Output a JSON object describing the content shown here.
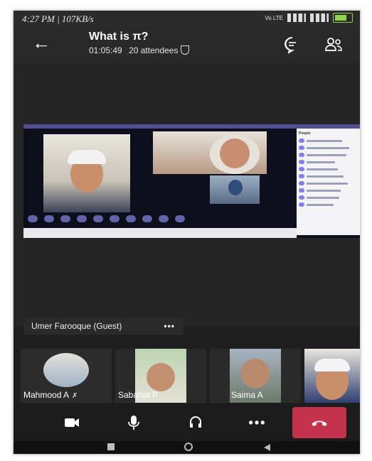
{
  "status_bar": {
    "time_speed": "4:27 PM | 107KB/s",
    "network": "Vo LTE"
  },
  "header": {
    "title": "What is π?",
    "duration": "01:05:49",
    "attendees": "20 attendees"
  },
  "featured": {
    "name": "Umer Farooque (Guest)",
    "more": "•••"
  },
  "participants": [
    {
      "name": "Mahmood A",
      "muted": true
    },
    {
      "name": "Sabahat P",
      "muted": true
    },
    {
      "name": "Saima A",
      "muted": false
    },
    {
      "name": "",
      "muted": false
    }
  ],
  "call_controls": [
    {
      "icon": "video-camera-icon"
    },
    {
      "icon": "microphone-icon"
    },
    {
      "icon": "headset-icon"
    },
    {
      "icon": "more-options-icon"
    },
    {
      "icon": "hang-up-icon"
    }
  ],
  "colors": {
    "hangup": "#c4314b",
    "accent": "#6264a7"
  }
}
